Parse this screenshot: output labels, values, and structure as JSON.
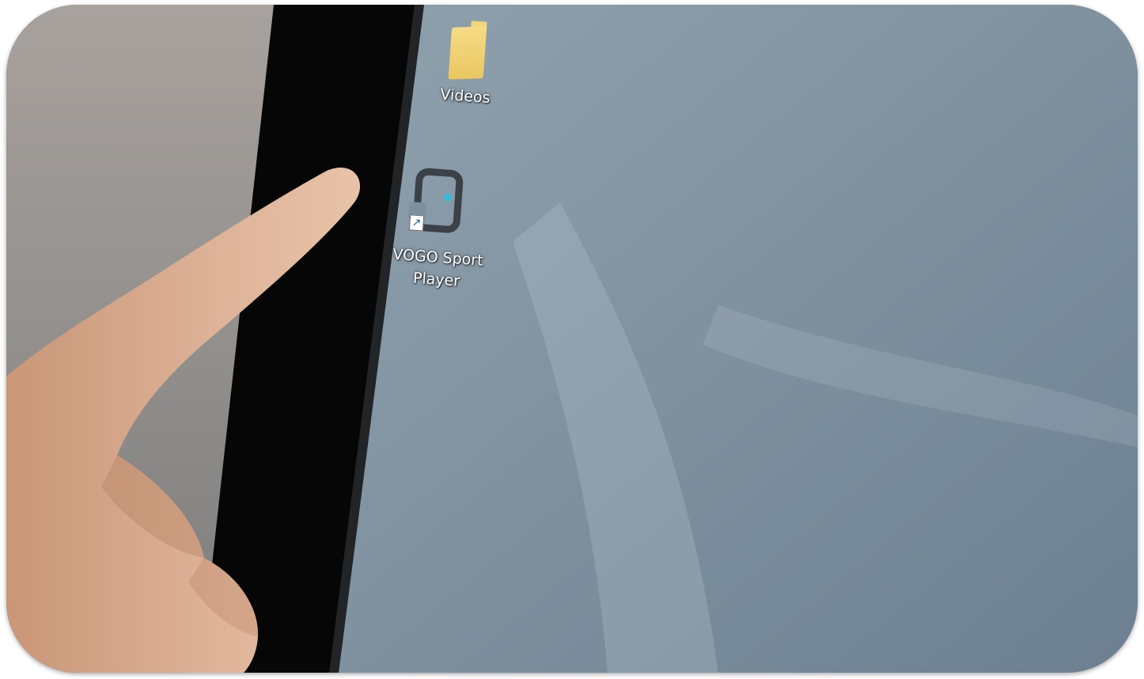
{
  "desktop": {
    "icons": [
      {
        "label": "Videos",
        "icon": "folder-icon"
      },
      {
        "label_line1": "VOGO Sport",
        "label_line2": "Player",
        "icon": "vogo-sport-player-icon",
        "overlay": "shortcut-arrow-icon"
      }
    ]
  },
  "colors": {
    "wallpaper": "#7f919f",
    "bezel": "#060606",
    "background_wall": "#8f8f8c",
    "skin": "#d7a98c"
  }
}
